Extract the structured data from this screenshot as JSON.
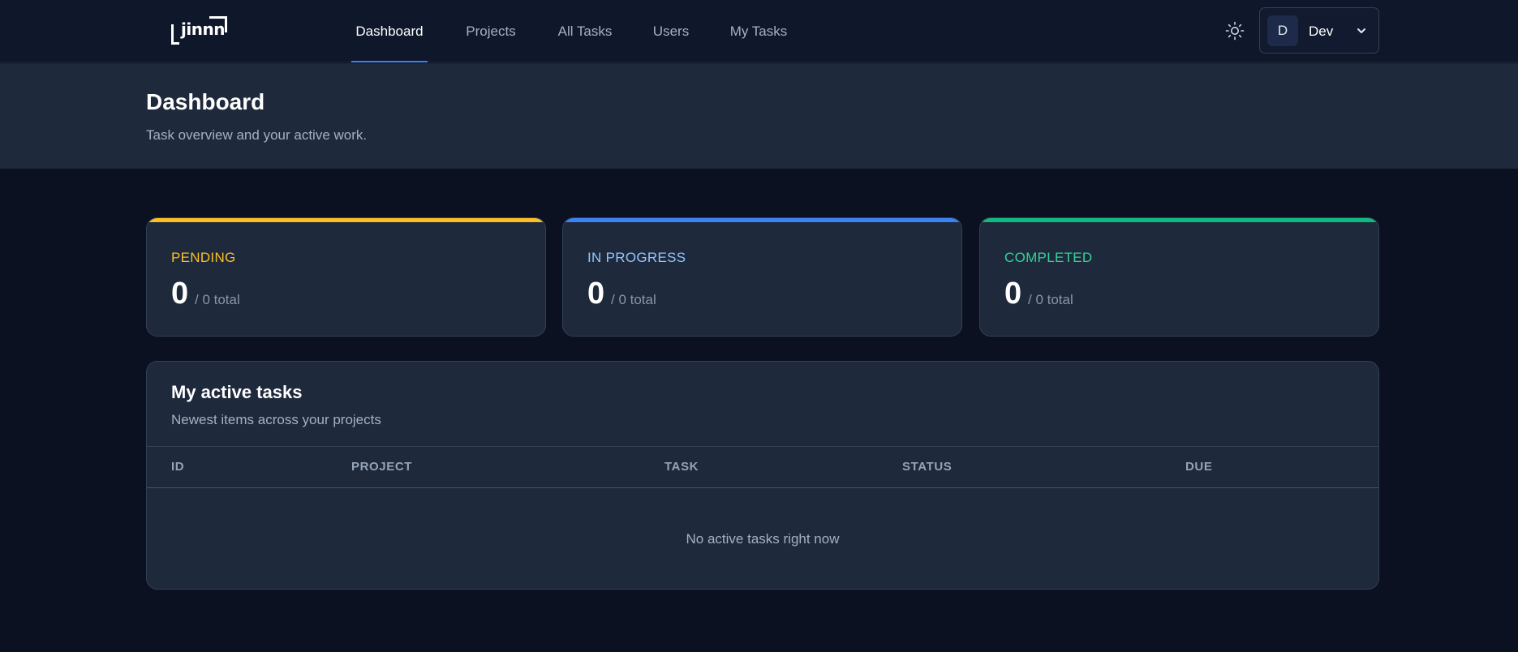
{
  "brand": {
    "name": "jinnn"
  },
  "nav": {
    "items": [
      {
        "label": "Dashboard",
        "active": true
      },
      {
        "label": "Projects",
        "active": false
      },
      {
        "label": "All Tasks",
        "active": false
      },
      {
        "label": "Users",
        "active": false
      },
      {
        "label": "My Tasks",
        "active": false
      }
    ]
  },
  "header_actions": {
    "theme_icon": "sun-icon",
    "user": {
      "initial": "D",
      "name": "Dev",
      "menu_icon": "chevron-down-icon"
    }
  },
  "page": {
    "title": "Dashboard",
    "subtitle": "Task overview and your active work."
  },
  "stats": [
    {
      "label": "PENDING",
      "value": "0",
      "total": "/ 0 total",
      "color": "#fbbf24"
    },
    {
      "label": "IN PROGRESS",
      "value": "0",
      "total": "/ 0 total",
      "color": "#3b82f6",
      "label_color": "#93c5fd"
    },
    {
      "label": "COMPLETED",
      "value": "0",
      "total": "/ 0 total",
      "color": "#10b981",
      "label_color": "#34d399"
    }
  ],
  "active_tasks": {
    "title": "My active tasks",
    "subtitle": "Newest items across your projects",
    "columns": [
      "ID",
      "PROJECT",
      "TASK",
      "STATUS",
      "DUE"
    ],
    "rows": [],
    "empty_message": "No active tasks right now"
  }
}
